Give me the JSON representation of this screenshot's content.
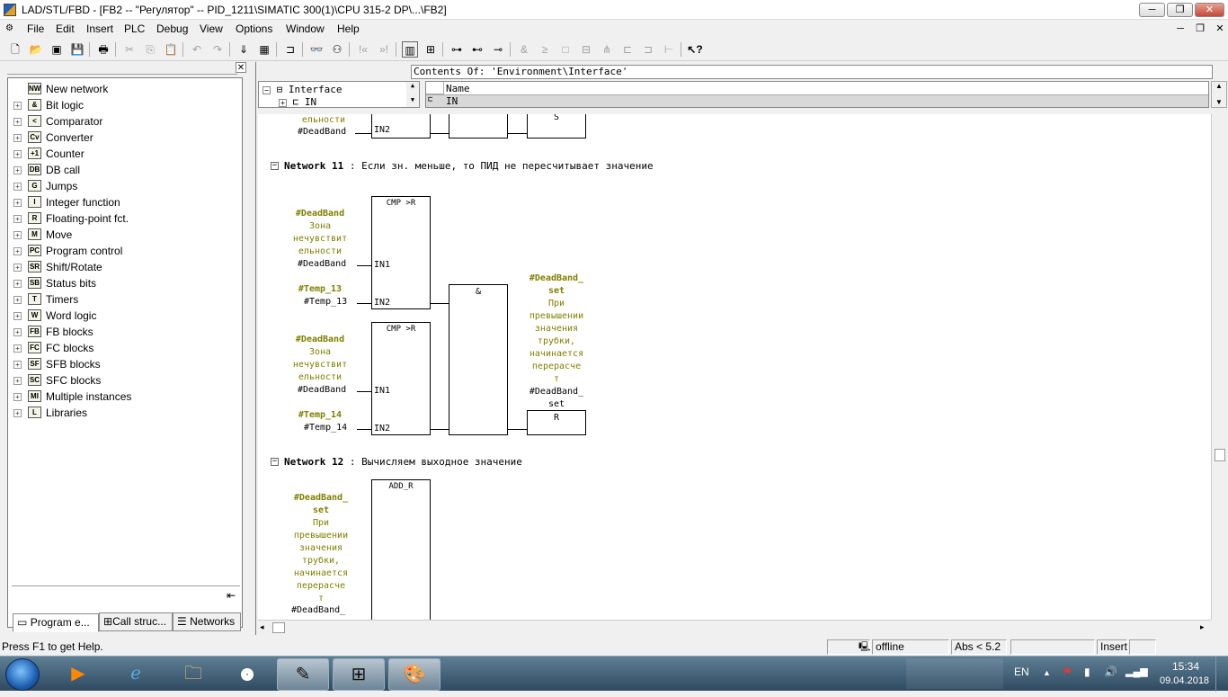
{
  "window": {
    "title": "LAD/STL/FBD  - [FB2 -- \"Регулятор\" -- PID_1211\\SIMATIC 300(1)\\CPU 315-2 DP\\...\\FB2]"
  },
  "menu": [
    "File",
    "Edit",
    "Insert",
    "PLC",
    "Debug",
    "View",
    "Options",
    "Window",
    "Help"
  ],
  "toolbar_icons": [
    "new-icon",
    "open-icon",
    "accessible-nodes-icon",
    "save-icon",
    "print-icon",
    "cut-icon",
    "copy-icon",
    "paste-icon",
    "undo-icon",
    "redo-icon",
    "download-icon",
    "online-icon",
    "monitor-icon",
    "glasses-icon",
    "prev-icon",
    "next-icon",
    "overview-icon",
    "zoom-icon",
    "network-icon",
    "branch-icon",
    "close-branch-icon",
    "and-box-icon",
    "or-box-icon",
    "empty-box-icon",
    "branch-open-icon",
    "branch-close-icon",
    "connection-icon",
    "help-cursor-icon"
  ],
  "catalog": {
    "items": [
      {
        "label": "New network",
        "icon": "NW"
      },
      {
        "label": "Bit logic",
        "icon": "&"
      },
      {
        "label": "Comparator",
        "icon": "<"
      },
      {
        "label": "Converter",
        "icon": "Cv"
      },
      {
        "label": "Counter",
        "icon": "+1"
      },
      {
        "label": "DB call",
        "icon": "DB"
      },
      {
        "label": "Jumps",
        "icon": "G"
      },
      {
        "label": "Integer function",
        "icon": "I"
      },
      {
        "label": "Floating-point fct.",
        "icon": "R"
      },
      {
        "label": "Move",
        "icon": "M"
      },
      {
        "label": "Program control",
        "icon": "PC"
      },
      {
        "label": "Shift/Rotate",
        "icon": "SR"
      },
      {
        "label": "Status bits",
        "icon": "SB"
      },
      {
        "label": "Timers",
        "icon": "T"
      },
      {
        "label": "Word logic",
        "icon": "W"
      },
      {
        "label": "FB blocks",
        "icon": "FB"
      },
      {
        "label": "FC blocks",
        "icon": "FC"
      },
      {
        "label": "SFB blocks",
        "icon": "SF"
      },
      {
        "label": "SFC blocks",
        "icon": "SC"
      },
      {
        "label": "Multiple instances",
        "icon": "MI"
      },
      {
        "label": "Libraries",
        "icon": "L"
      }
    ],
    "tabs": [
      "Program e...",
      "Call struc...",
      "Networks"
    ]
  },
  "interface": {
    "header": "Contents Of: 'Environment\\Interface'",
    "tree_root": "Interface",
    "tree_child": "IN",
    "name_col": "Name",
    "name_row": "IN"
  },
  "networks": {
    "n10": {
      "olive_tail": "ельности",
      "var": "#DeadBand",
      "pin": "IN2",
      "coil": "S"
    },
    "n11": {
      "number": "Network 11",
      "comment": ": Если зн. меньше, то ПИД не пересчитывает значение",
      "cmp1": {
        "name": "CMP >R",
        "in1": "IN1",
        "in2": "IN2"
      },
      "cmp2": {
        "name": "CMP >R",
        "in1": "IN1",
        "in2": "IN2"
      },
      "and": "&",
      "a1": {
        "sym": "#DeadBand",
        "c1": "Зона",
        "c2": "нечувствит",
        "c3": "ельности",
        "var": "#DeadBand"
      },
      "a2": {
        "sym": "#Temp_13",
        "var": "#Temp_13"
      },
      "a3": {
        "sym": "#DeadBand",
        "c1": "Зона",
        "c2": "нечувствит",
        "c3": "ельности",
        "var": "#DeadBand"
      },
      "a4": {
        "sym": "#Temp_14",
        "var": "#Temp_14"
      },
      "out": {
        "sym1": "#DeadBand_",
        "sym2": "set",
        "c1": "При",
        "c2": "превышении",
        "c3": "значения",
        "c4": "трубки,",
        "c5": "начинается",
        "c6": "перерасче",
        "c7": "т",
        "var1": "#DeadBand_",
        "var2": "set"
      },
      "coil": "R"
    },
    "n12": {
      "number": "Network 12",
      "comment": ": Вычисляем выходное значение",
      "block": "ADD_R",
      "in": {
        "sym1": "#DeadBand_",
        "sym2": "set",
        "c1": "При",
        "c2": "превышении",
        "c3": "значения",
        "c4": "трубки,",
        "c5": "начинается",
        "c6": "перерасче",
        "c7": "т",
        "var": "#DeadBand_"
      }
    }
  },
  "status": {
    "help": "Press F1 to get Help.",
    "online": "offline",
    "abs": "Abs < 5.2",
    "mode": "Insert"
  },
  "taskbar": {
    "lang": "EN",
    "time": "15:34",
    "date": "09.04.2018"
  }
}
